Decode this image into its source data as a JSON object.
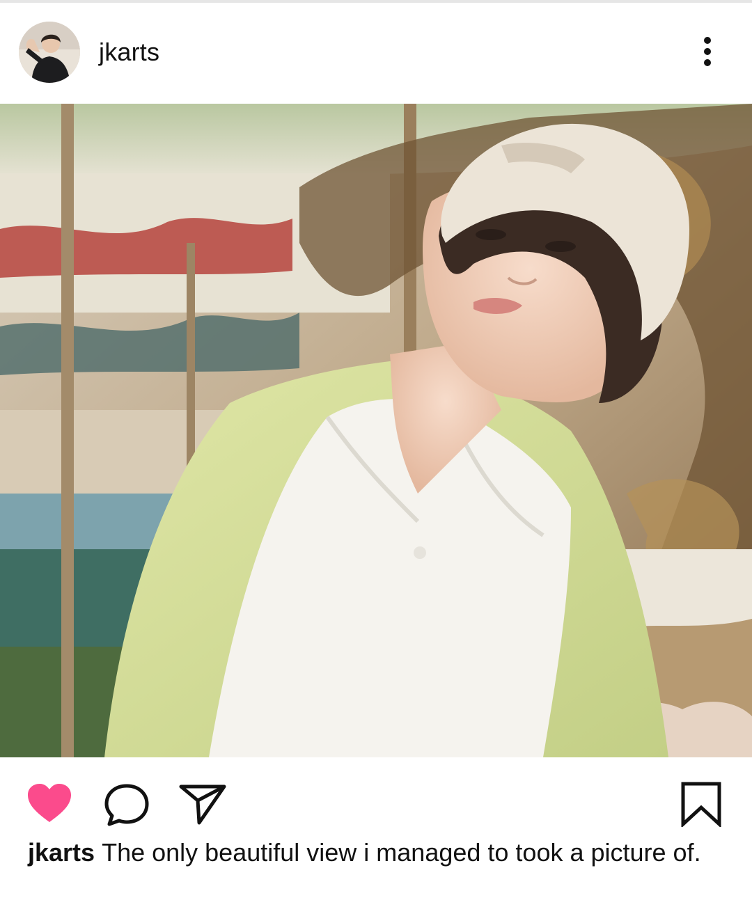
{
  "post": {
    "username": "jkarts",
    "caption_user": "jkarts",
    "caption_text": "The only beautiful view i managed to took a picture of."
  },
  "icons": {
    "more": "more-vertical-icon",
    "like": "heart-icon",
    "comment": "comment-icon",
    "share": "send-icon",
    "save": "bookmark-icon"
  },
  "colors": {
    "like_active": "#fb4b8c",
    "icon_stroke": "#111111"
  },
  "state": {
    "liked": true
  }
}
